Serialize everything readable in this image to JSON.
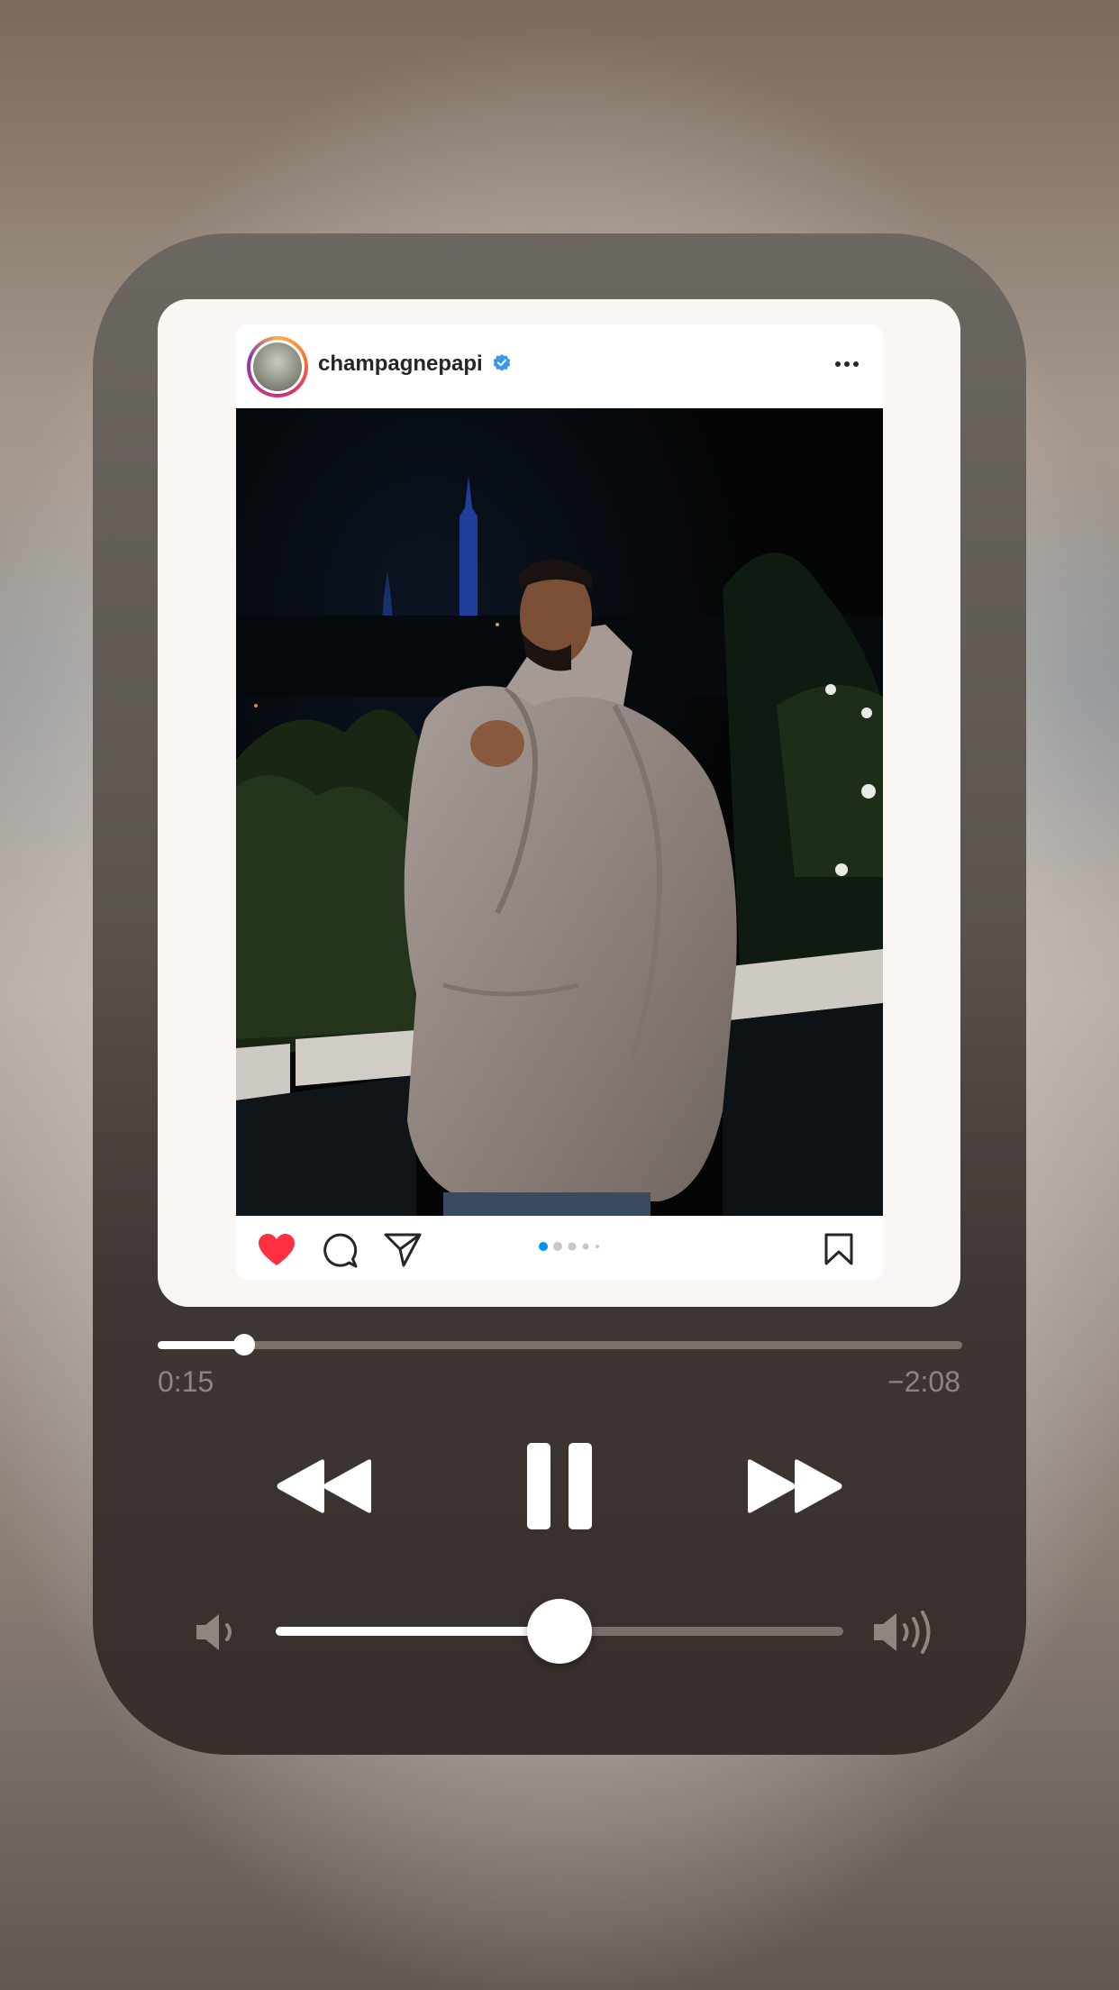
{
  "post": {
    "username": "champagnepapi",
    "verified": true,
    "liked": true,
    "carousel": {
      "total": 5,
      "active": 1
    }
  },
  "player": {
    "elapsed": "0:15",
    "remaining": "−2:08",
    "progress": 0.107,
    "volume": 0.5,
    "playing": true
  },
  "colors": {
    "heart": "#ff3040",
    "verified": "#3897f0",
    "dot_active": "#0095f6",
    "dot_inactive": "#c7c7c7"
  },
  "icons": {
    "like": "heart-icon",
    "comment": "comment-icon",
    "share": "paper-plane-icon",
    "save": "bookmark-icon",
    "more": "more-icon",
    "rewind": "rewind-icon",
    "pause": "pause-icon",
    "forward": "fast-forward-icon",
    "volume_low": "volume-low-icon",
    "volume_high": "volume-high-icon"
  }
}
